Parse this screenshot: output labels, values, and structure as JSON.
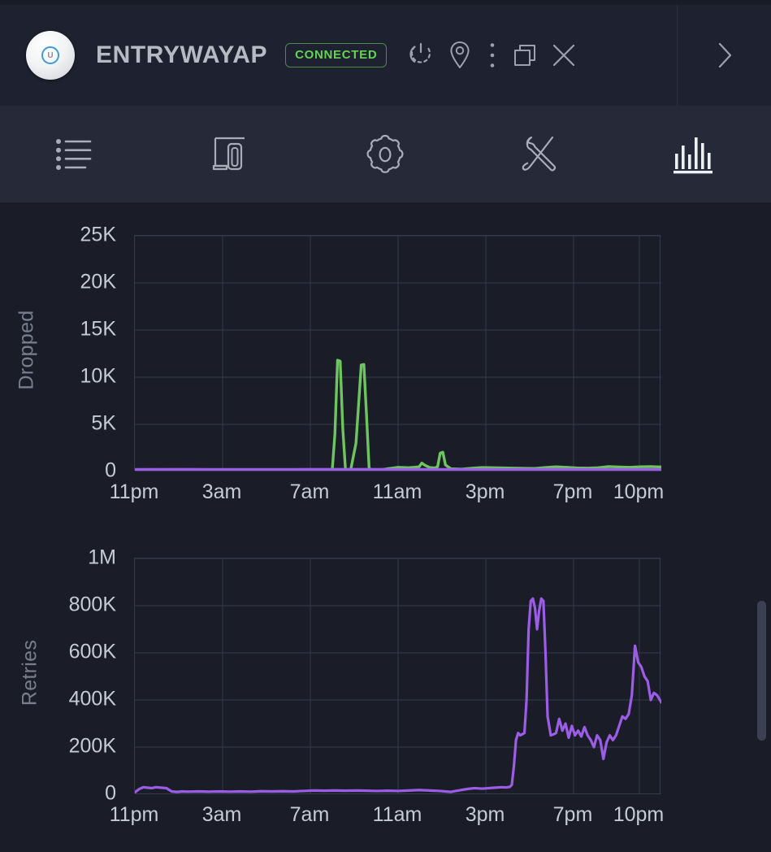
{
  "header": {
    "device_name": "ENTRYWAYAP",
    "status_badge": "CONNECTED",
    "avatar_logo": "U",
    "icons": [
      {
        "name": "power-icon",
        "label": "Power Cycle"
      },
      {
        "name": "location-pin-icon",
        "label": "Locate"
      },
      {
        "name": "more-vertical-icon",
        "label": "More"
      },
      {
        "name": "copy-window-icon",
        "label": "Detach"
      },
      {
        "name": "close-icon",
        "label": "Close"
      }
    ],
    "expand_icon": "chevron-right-icon"
  },
  "tabs": [
    {
      "name": "tab-details",
      "icon": "list-icon",
      "label": "Details",
      "active": false
    },
    {
      "name": "tab-clients",
      "icon": "devices-icon",
      "label": "Clients",
      "active": false
    },
    {
      "name": "tab-settings",
      "icon": "gear-icon",
      "label": "Settings",
      "active": false
    },
    {
      "name": "tab-tools",
      "icon": "tools-icon",
      "label": "Tools",
      "active": false
    },
    {
      "name": "tab-statistics",
      "icon": "bar-chart-icon",
      "label": "Statistics",
      "active": true
    }
  ],
  "colors": {
    "green_series": "#6ec45e",
    "purple_series": "#9b5de5",
    "accent_green": "#63d44f",
    "accent_blue": "#3e9ae0",
    "header_bg": "#1e2130",
    "tabbar_bg": "#262a38",
    "chart_bg": "#1a1d28",
    "grid": "#343a4b",
    "tick_text": "#c6cad4",
    "axis_title": "#787e8e"
  },
  "chart_data": [
    {
      "type": "line",
      "title": "",
      "name": "dropped-chart",
      "ylabel": "Dropped",
      "xlabel": "",
      "ylim": [
        0,
        25000
      ],
      "yticks": [
        0,
        5000,
        10000,
        15000,
        20000,
        25000
      ],
      "ytick_labels": [
        "0",
        "5K",
        "10K",
        "15K",
        "20K",
        "25K"
      ],
      "xtick_labels": [
        "11pm",
        "3am",
        "7am",
        "11am",
        "3pm",
        "7pm",
        "10pm"
      ],
      "xtick_positions": [
        0,
        0.1667,
        0.3333,
        0.5,
        0.6667,
        0.8333,
        0.9583
      ],
      "grid": true,
      "legend": "none",
      "series": [
        {
          "name": "Dropped (green)",
          "color": "#6ec45e",
          "x": [
            0,
            0.02,
            0.04,
            0.06,
            0.08,
            0.1,
            0.12,
            0.14,
            0.16,
            0.18,
            0.2,
            0.22,
            0.24,
            0.26,
            0.28,
            0.3,
            0.32,
            0.34,
            0.36,
            0.375,
            0.38,
            0.385,
            0.39,
            0.395,
            0.4,
            0.405,
            0.41,
            0.42,
            0.43,
            0.435,
            0.44,
            0.445,
            0.45,
            0.455,
            0.46,
            0.47,
            0.48,
            0.5,
            0.52,
            0.54,
            0.545,
            0.55,
            0.56,
            0.57,
            0.575,
            0.58,
            0.585,
            0.59,
            0.6,
            0.62,
            0.64,
            0.66,
            0.68,
            0.7,
            0.72,
            0.74,
            0.76,
            0.78,
            0.8,
            0.82,
            0.84,
            0.86,
            0.88,
            0.9,
            0.92,
            0.94,
            0.96,
            0.98,
            1.0
          ],
          "values": [
            120,
            140,
            120,
            110,
            130,
            120,
            110,
            140,
            120,
            110,
            130,
            120,
            140,
            120,
            110,
            130,
            120,
            110,
            140,
            200,
            4000,
            11800,
            11700,
            4500,
            260,
            200,
            180,
            3000,
            11300,
            11350,
            6000,
            300,
            200,
            180,
            160,
            200,
            300,
            450,
            400,
            500,
            900,
            700,
            420,
            380,
            500,
            1950,
            2050,
            700,
            300,
            250,
            350,
            420,
            400,
            380,
            360,
            340,
            330,
            420,
            500,
            450,
            380,
            360,
            400,
            520,
            480,
            450,
            500,
            520,
            480
          ]
        },
        {
          "name": "Dropped (purple)",
          "color": "#9b5de5",
          "x": [
            0,
            0.1,
            0.2,
            0.3,
            0.4,
            0.5,
            0.6,
            0.7,
            0.8,
            0.9,
            1.0
          ],
          "values": [
            220,
            230,
            215,
            225,
            230,
            220,
            215,
            225,
            230,
            220,
            225
          ]
        }
      ]
    },
    {
      "type": "line",
      "title": "",
      "name": "retries-chart",
      "ylabel": "Retries",
      "xlabel": "",
      "ylim": [
        0,
        1000000
      ],
      "yticks": [
        0,
        200000,
        400000,
        600000,
        800000,
        1000000
      ],
      "ytick_labels": [
        "0",
        "200K",
        "400K",
        "600K",
        "800K",
        "1M"
      ],
      "xtick_labels": [
        "11pm",
        "3am",
        "7am",
        "11am",
        "3pm",
        "7pm",
        "10pm"
      ],
      "xtick_positions": [
        0,
        0.1667,
        0.3333,
        0.5,
        0.6667,
        0.8333,
        0.9583
      ],
      "grid": true,
      "legend": "none",
      "series": [
        {
          "name": "Retries",
          "color": "#9b5de5",
          "x": [
            0,
            0.008,
            0.016,
            0.024,
            0.032,
            0.04,
            0.05,
            0.06,
            0.07,
            0.08,
            0.09,
            0.1,
            0.12,
            0.14,
            0.16,
            0.18,
            0.2,
            0.22,
            0.24,
            0.26,
            0.28,
            0.3,
            0.32,
            0.34,
            0.36,
            0.38,
            0.4,
            0.42,
            0.44,
            0.46,
            0.48,
            0.5,
            0.52,
            0.54,
            0.56,
            0.58,
            0.6,
            0.615,
            0.63,
            0.645,
            0.66,
            0.672,
            0.684,
            0.696,
            0.705,
            0.712,
            0.716,
            0.72,
            0.724,
            0.728,
            0.732,
            0.736,
            0.74,
            0.744,
            0.748,
            0.752,
            0.756,
            0.76,
            0.764,
            0.768,
            0.772,
            0.776,
            0.78,
            0.784,
            0.79,
            0.796,
            0.8,
            0.806,
            0.812,
            0.818,
            0.824,
            0.83,
            0.836,
            0.842,
            0.848,
            0.854,
            0.86,
            0.866,
            0.872,
            0.878,
            0.884,
            0.89,
            0.896,
            0.902,
            0.908,
            0.914,
            0.92,
            0.926,
            0.932,
            0.938,
            0.944,
            0.95,
            0.956,
            0.962,
            0.968,
            0.974,
            0.98,
            0.986,
            0.992,
            1.0
          ],
          "values": [
            8000,
            22000,
            30000,
            28000,
            26000,
            30000,
            28000,
            26000,
            12000,
            10000,
            12000,
            11000,
            12000,
            11000,
            12000,
            11000,
            12000,
            11000,
            13000,
            12000,
            13000,
            12000,
            14000,
            16000,
            15000,
            16000,
            15000,
            16000,
            15000,
            14000,
            15000,
            14000,
            16000,
            18000,
            16000,
            14000,
            10000,
            16000,
            22000,
            26000,
            24000,
            26000,
            28000,
            30000,
            29000,
            31000,
            40000,
            120000,
            230000,
            260000,
            250000,
            255000,
            260000,
            400000,
            700000,
            820000,
            830000,
            790000,
            700000,
            780000,
            830000,
            820000,
            600000,
            330000,
            250000,
            255000,
            260000,
            320000,
            270000,
            300000,
            240000,
            290000,
            250000,
            270000,
            245000,
            285000,
            250000,
            230000,
            200000,
            250000,
            230000,
            150000,
            220000,
            250000,
            230000,
            250000,
            290000,
            330000,
            320000,
            340000,
            420000,
            630000,
            560000,
            540000,
            500000,
            480000,
            400000,
            430000,
            420000,
            390000
          ]
        }
      ]
    }
  ],
  "scrollbar": {
    "name": "vertical-scrollbar",
    "thumb_top_ratio": 0.78
  }
}
